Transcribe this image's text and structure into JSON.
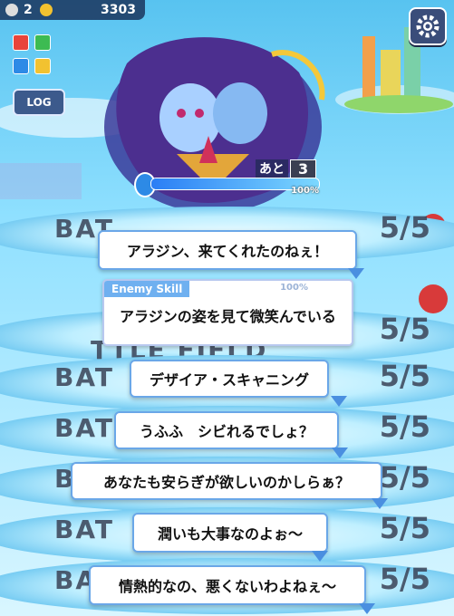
{
  "hud": {
    "count": "2",
    "coins": "3303"
  },
  "log_label": "LOG",
  "boss": {
    "turns_label": "あと",
    "turns_value": "3",
    "hp_text": "100%",
    "hp_fraction": 1.0
  },
  "field_text": {
    "battle": "BAT",
    "battle_field": "TTLE FIELD",
    "stage": "5/5"
  },
  "enemy_skill": {
    "tag": "Enemy Skill",
    "text": "アラジンの姿を見て微笑んでいる",
    "hp_text": "100%"
  },
  "bubbles": [
    "アラジン、来てくれたのねぇ！",
    "デザイア・スキャニング",
    "うふふ　シビれるでしょ？",
    "あなたも安らぎが欲しいのかしらぁ？",
    "潤いも大事なのよぉ～",
    "情熱的なの、悪くないわよねぇ～"
  ],
  "colors": {
    "accent": "#6aa7e8",
    "hud_bg": "#142850",
    "hp_fill": "#2a7ef5"
  }
}
